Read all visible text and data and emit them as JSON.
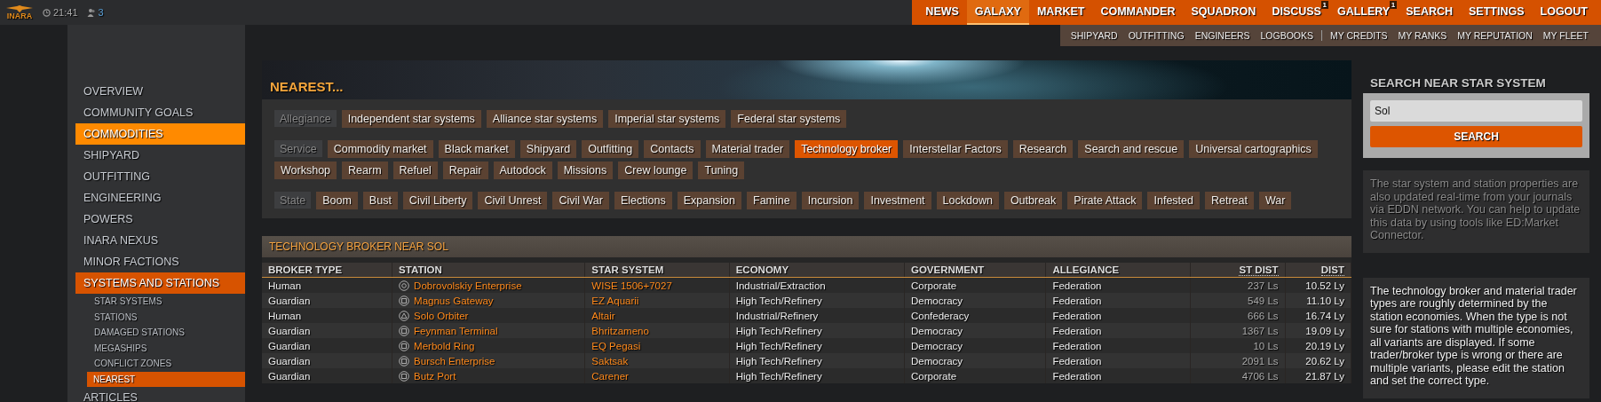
{
  "header": {
    "logo_text": "INARA",
    "time": "21:41",
    "online_count": "3",
    "nav": [
      {
        "label": "NEWS",
        "selected": false
      },
      {
        "label": "GALAXY",
        "selected": true
      },
      {
        "label": "MARKET",
        "selected": false
      },
      {
        "label": "COMMANDER",
        "selected": false
      },
      {
        "label": "SQUADRON",
        "selected": false
      },
      {
        "label": "DISCUSS",
        "selected": false,
        "badge": "1"
      },
      {
        "label": "GALLERY",
        "selected": false,
        "badge": "1"
      },
      {
        "label": "SEARCH",
        "selected": false
      },
      {
        "label": "SETTINGS",
        "selected": false
      },
      {
        "label": "LOGOUT",
        "selected": false
      }
    ],
    "subnav": [
      [
        "SHIPYARD",
        "OUTFITTING",
        "ENGINEERS",
        "LOGBOOKS"
      ],
      [
        "MY CREDITS",
        "MY RANKS",
        "MY REPUTATION",
        "MY FLEET"
      ]
    ]
  },
  "sidebar": {
    "items": [
      {
        "label": "OVERVIEW",
        "selected": false,
        "highlighted": false
      },
      {
        "label": "COMMUNITY GOALS",
        "selected": false,
        "highlighted": false
      },
      {
        "label": "COMMODITIES",
        "selected": false,
        "highlighted": true
      },
      {
        "label": "SHIPYARD",
        "selected": false,
        "highlighted": false
      },
      {
        "label": "OUTFITTING",
        "selected": false,
        "highlighted": false
      },
      {
        "label": "ENGINEERING",
        "selected": false,
        "highlighted": false
      },
      {
        "label": "POWERS",
        "selected": false,
        "highlighted": false
      },
      {
        "label": "INARA NEXUS",
        "selected": false,
        "highlighted": false
      },
      {
        "label": "MINOR FACTIONS",
        "selected": false,
        "highlighted": false
      },
      {
        "label": "SYSTEMS AND STATIONS",
        "selected": true,
        "highlighted": false,
        "children": [
          {
            "label": "STAR SYSTEMS",
            "selected": false
          },
          {
            "label": "STATIONS",
            "selected": false
          },
          {
            "label": "DAMAGED STATIONS",
            "selected": false
          },
          {
            "label": "MEGASHIPS",
            "selected": false
          },
          {
            "label": "CONFLICT ZONES",
            "selected": false
          },
          {
            "label": "NEAREST",
            "selected": true
          }
        ]
      },
      {
        "label": "ARTICLES",
        "selected": false,
        "highlighted": false
      }
    ]
  },
  "main": {
    "title": "NEAREST...",
    "filters": [
      {
        "label": "Allegiance",
        "options": [
          {
            "label": "Independent star systems",
            "selected": false
          },
          {
            "label": "Alliance star systems",
            "selected": false
          },
          {
            "label": "Imperial star systems",
            "selected": false
          },
          {
            "label": "Federal star systems",
            "selected": false
          }
        ]
      },
      {
        "label": "Service",
        "options": [
          {
            "label": "Commodity market",
            "selected": false
          },
          {
            "label": "Black market",
            "selected": false
          },
          {
            "label": "Shipyard",
            "selected": false
          },
          {
            "label": "Outfitting",
            "selected": false
          },
          {
            "label": "Contacts",
            "selected": false
          },
          {
            "label": "Material trader",
            "selected": false
          },
          {
            "label": "Technology broker",
            "selected": true
          },
          {
            "label": "Interstellar Factors",
            "selected": false
          },
          {
            "label": "Research",
            "selected": false
          },
          {
            "label": "Search and rescue",
            "selected": false
          },
          {
            "label": "Universal cartographics",
            "selected": false
          },
          {
            "label": "Workshop",
            "selected": false
          },
          {
            "label": "Rearm",
            "selected": false
          },
          {
            "label": "Refuel",
            "selected": false
          },
          {
            "label": "Repair",
            "selected": false
          },
          {
            "label": "Autodock",
            "selected": false
          },
          {
            "label": "Missions",
            "selected": false
          },
          {
            "label": "Crew lounge",
            "selected": false
          },
          {
            "label": "Tuning",
            "selected": false
          }
        ]
      },
      {
        "label": "State",
        "options": [
          {
            "label": "Boom",
            "selected": false
          },
          {
            "label": "Bust",
            "selected": false
          },
          {
            "label": "Civil Liberty",
            "selected": false
          },
          {
            "label": "Civil Unrest",
            "selected": false
          },
          {
            "label": "Civil War",
            "selected": false
          },
          {
            "label": "Elections",
            "selected": false
          },
          {
            "label": "Expansion",
            "selected": false
          },
          {
            "label": "Famine",
            "selected": false
          },
          {
            "label": "Incursion",
            "selected": false
          },
          {
            "label": "Investment",
            "selected": false
          },
          {
            "label": "Lockdown",
            "selected": false
          },
          {
            "label": "Outbreak",
            "selected": false
          },
          {
            "label": "Pirate Attack",
            "selected": false
          },
          {
            "label": "Infested",
            "selected": false
          },
          {
            "label": "Retreat",
            "selected": false
          },
          {
            "label": "War",
            "selected": false
          }
        ]
      }
    ],
    "table": {
      "title": "TECHNOLOGY BROKER NEAR SOL",
      "columns": [
        "BROKER TYPE",
        "STATION",
        "STAR SYSTEM",
        "ECONOMY",
        "GOVERNMENT",
        "ALLEGIANCE",
        "ST DIST",
        "DIST"
      ],
      "rows": [
        {
          "broker_type": "Human",
          "station": "Dobrovolskiy Enterprise",
          "kind": "ring",
          "star_system": "WISE 1506+7027",
          "economy": "Industrial/Extraction",
          "government": "Corporate",
          "allegiance": "Federation",
          "st_dist": "237 Ls",
          "dist": "10.52 Ly"
        },
        {
          "broker_type": "Guardian",
          "station": "Magnus Gateway",
          "kind": "square",
          "star_system": "EZ Aquarii",
          "economy": "High Tech/Refinery",
          "government": "Democracy",
          "allegiance": "Federation",
          "st_dist": "549 Ls",
          "dist": "11.10 Ly"
        },
        {
          "broker_type": "Human",
          "station": "Solo Orbiter",
          "kind": "triangle",
          "star_system": "Altair",
          "economy": "Industrial/Refinery",
          "government": "Confederacy",
          "allegiance": "Federation",
          "st_dist": "666 Ls",
          "dist": "16.74 Ly"
        },
        {
          "broker_type": "Guardian",
          "station": "Feynman Terminal",
          "kind": "square",
          "star_system": "Bhritzameno",
          "economy": "High Tech/Refinery",
          "government": "Democracy",
          "allegiance": "Federation",
          "st_dist": "1367 Ls",
          "dist": "19.09 Ly"
        },
        {
          "broker_type": "Guardian",
          "station": "Merbold Ring",
          "kind": "square",
          "star_system": "EQ Pegasi",
          "economy": "High Tech/Refinery",
          "government": "Democracy",
          "allegiance": "Federation",
          "st_dist": "10 Ls",
          "dist": "20.19 Ly"
        },
        {
          "broker_type": "Guardian",
          "station": "Bursch Enterprise",
          "kind": "square",
          "star_system": "Saktsak",
          "economy": "High Tech/Refinery",
          "government": "Democracy",
          "allegiance": "Federation",
          "st_dist": "2091 Ls",
          "dist": "20.62 Ly"
        },
        {
          "broker_type": "Guardian",
          "station": "Butz Port",
          "kind": "square",
          "star_system": "Carener",
          "economy": "High Tech/Refinery",
          "government": "Corporate",
          "allegiance": "Federation",
          "st_dist": "4706 Ls",
          "dist": "21.87 Ly"
        }
      ]
    }
  },
  "side_panel": {
    "title": "SEARCH NEAR STAR SYSTEM",
    "search": {
      "value": "Sol",
      "button": "SEARCH"
    },
    "notes": [
      "The star system and station properties are also updated real-time from your journals via EDDN network. You can help to update this data by using tools like ED:Market Connector.",
      "The technology broker and material trader types are roughly determined by the station economies. When the type is not sure for stations with multiple economies, all variants are displayed. If some trader/broker type is wrong or there are multiple variants, please edit the station and set the correct type."
    ]
  }
}
